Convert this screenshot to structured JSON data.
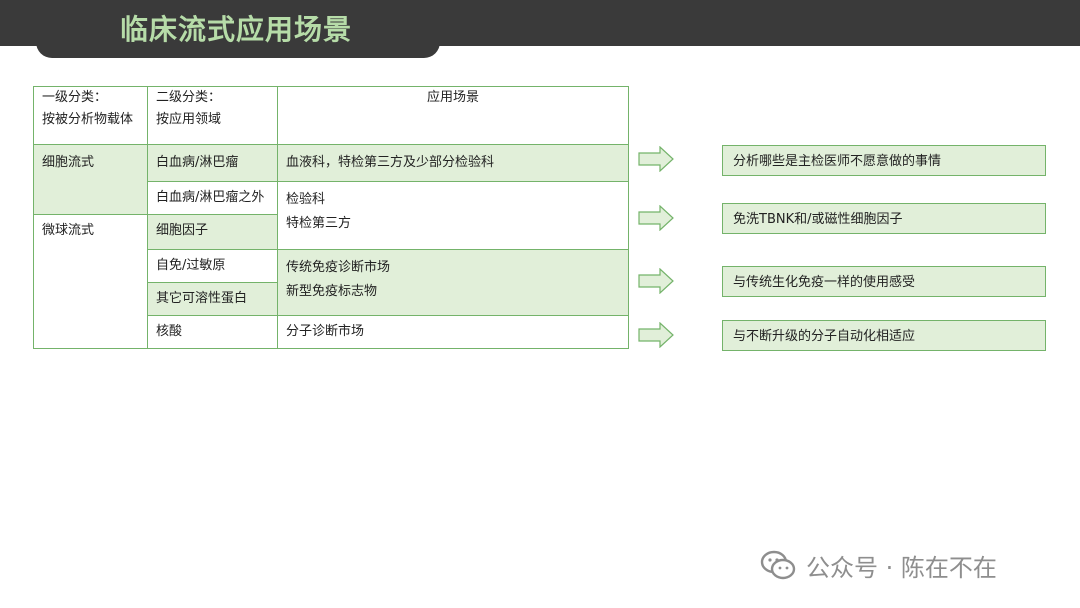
{
  "title": "临床流式应用场景",
  "table": {
    "headers": {
      "col1_line1": "一级分类：",
      "col1_line2": "按被分析物载体",
      "col2_line1": "二级分类：",
      "col2_line2": "按应用领域",
      "col3": "应用场景"
    },
    "primary": {
      "cell_flow": "细胞流式",
      "bead_flow": "微球流式"
    },
    "secondary": {
      "leukemia": "白血病/淋巴瘤",
      "non_leukemia": "白血病/淋巴瘤之外",
      "cytokine": "细胞因子",
      "autoimmune": "自免/过敏原",
      "soluble_protein": "其它可溶性蛋白",
      "nucleic_acid": "核酸"
    },
    "scenarios": {
      "s1": "血液科，特检第三方及少部分检验科",
      "s2_line1": "检验科",
      "s2_line2": "特检第三方",
      "s3_line1": "传统免疫诊断市场",
      "s3_line2": "新型免疫标志物",
      "s4": "分子诊断市场"
    }
  },
  "notes": [
    "分析哪些是主检医师不愿意做的事情",
    "免洗TBNK和/或磁性细胞因子",
    "与传统生化免疫一样的使用感受",
    "与不断升级的分子自动化相适应"
  ],
  "watermark": "公众号 · 陈在不在",
  "colors": {
    "header_bg": "#3a3a3a",
    "title_green": "#b6dca8",
    "border_green": "#74b36a",
    "fill_green": "#e1efd9"
  }
}
